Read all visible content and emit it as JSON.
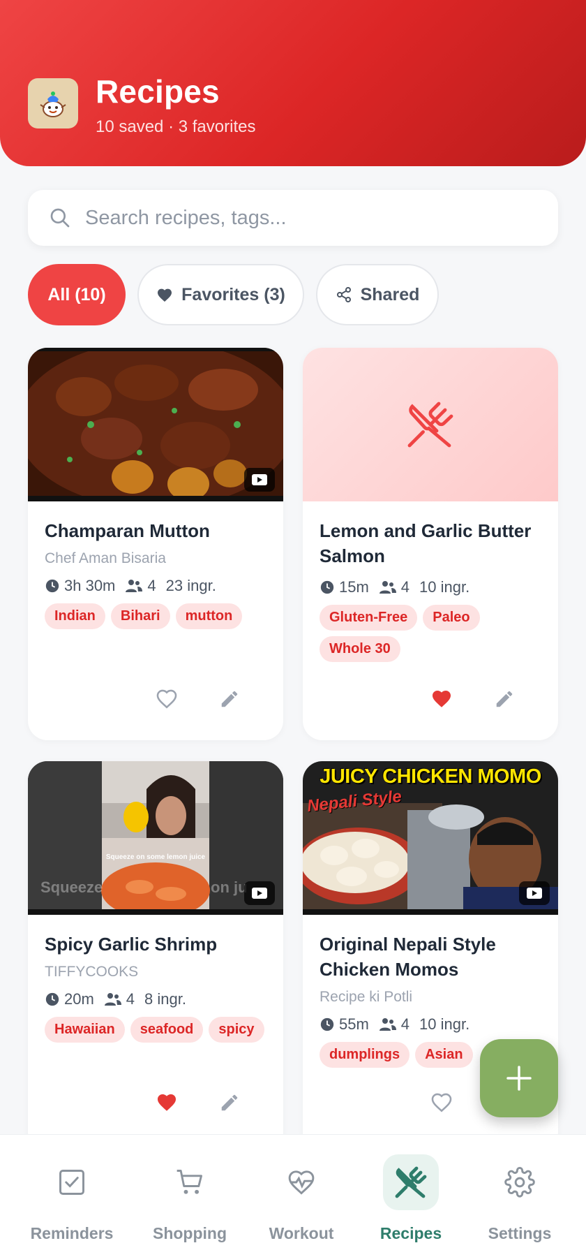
{
  "header": {
    "title": "Recipes",
    "subtitle": "10 saved · 3 favorites"
  },
  "search": {
    "placeholder": "Search recipes, tags..."
  },
  "filters": [
    {
      "label": "All (10)",
      "active": true
    },
    {
      "label": "Favorites (3)",
      "icon": "heart-icon",
      "active": false
    },
    {
      "label": "Shared",
      "icon": "share-icon",
      "active": false
    }
  ],
  "recipes": [
    {
      "title": "Champaran Mutton",
      "author": "Chef Aman Bisaria",
      "time": "3h 30m",
      "servings": "4",
      "ingredients": "23 ingr.",
      "tags": [
        "Indian",
        "Bihari",
        "mutton"
      ],
      "favorite": false,
      "has_video": true
    },
    {
      "title": "Lemon and Garlic Butter Salmon",
      "author": "",
      "time": "15m",
      "servings": "4",
      "ingredients": "10 ingr.",
      "tags": [
        "Gluten-Free",
        "Paleo",
        "Whole 30"
      ],
      "favorite": true,
      "has_video": false
    },
    {
      "title": "Spicy Garlic Shrimp",
      "author": "TIFFYCOOKS",
      "time": "20m",
      "servings": "4",
      "ingredients": "8 ingr.",
      "tags": [
        "Hawaiian",
        "seafood",
        "spicy"
      ],
      "favorite": true,
      "has_video": true,
      "thumb_caption": "Squeeze on some lemon juice",
      "thumb_overlay_left": "Squeeze",
      "thumb_overlay_right": "on ju"
    },
    {
      "title": "Original Nepali Style Chicken Momos",
      "author": "Recipe ki Potli",
      "time": "55m",
      "servings": "4",
      "ingredients": "10 ingr.",
      "tags": [
        "dumplings",
        "Asian"
      ],
      "favorite": false,
      "has_video": true,
      "thumb_headline": "JUICY CHICKEN MOMO",
      "thumb_subline": "Nepali Style"
    }
  ],
  "nav": [
    {
      "label": "Reminders",
      "icon": "checkbox-icon",
      "active": false
    },
    {
      "label": "Shopping",
      "icon": "cart-icon",
      "active": false
    },
    {
      "label": "Workout",
      "icon": "heart-pulse-icon",
      "active": false
    },
    {
      "label": "Recipes",
      "icon": "utensils-icon",
      "active": true
    },
    {
      "label": "Settings",
      "icon": "gear-icon",
      "active": false
    }
  ],
  "colors": {
    "primary": "#ef4444",
    "tag_bg": "#fde2e2",
    "fab": "#86ae61",
    "nav_active": "#2e7d6b"
  }
}
